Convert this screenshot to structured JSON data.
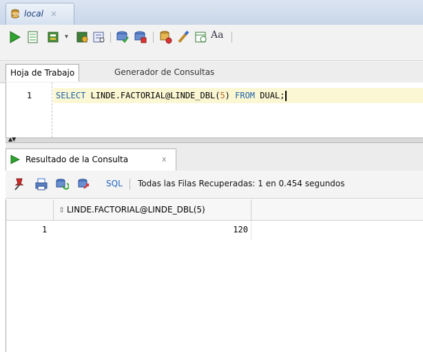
{
  "document_tab": {
    "title": "local",
    "close": "×"
  },
  "toolbar": {
    "icons": [
      "run-statement-icon",
      "run-script-icon",
      "commit-icon",
      "dropdown-icon",
      "autotrace-icon",
      "explain-plan-icon",
      "commit-transaction-icon",
      "rollback-icon",
      "sql-tuning-icon",
      "clear-icon",
      "history-icon",
      "format-case-icon"
    ]
  },
  "worksheet": {
    "tabs": [
      {
        "label": "Hoja de Trabajo",
        "active": true
      },
      {
        "label": "Generador de Consultas",
        "active": false
      }
    ],
    "editor": {
      "line_number": "1",
      "code": {
        "kw1": "SELECT",
        "mid1": " LINDE.FACTORIAL@LINDE_DBL(",
        "num": "5",
        "mid2": ") ",
        "kw2": "FROM",
        "tail": " DUAL;"
      }
    }
  },
  "results": {
    "tab": {
      "label": "Resultado de la Consulta",
      "close": "x"
    },
    "toolbar": {
      "sql_label": "SQL",
      "status": "Todas las Filas Recuperadas: 1 en 0.454 segundos"
    },
    "grid": {
      "columns": [
        "LINDE.FACTORIAL@LINDE_DBL(5)"
      ],
      "rows": [
        {
          "num": "1",
          "value": "120"
        }
      ]
    }
  },
  "colors": {
    "accent": "#1c5fa8",
    "run_green": "#2fa32f",
    "current_line": "#fbf7d3"
  }
}
